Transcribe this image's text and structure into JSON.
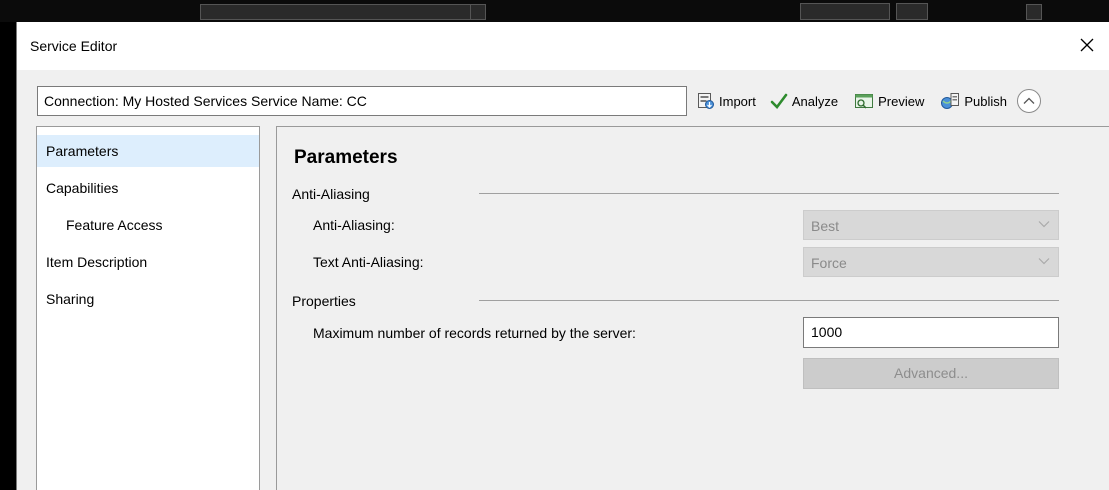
{
  "window": {
    "title": "Service Editor",
    "close_glyph": "✕"
  },
  "connection": {
    "text": "Connection: My Hosted Services   Service Name: CC"
  },
  "toolbar": {
    "import_label": "Import",
    "analyze_label": "Analyze",
    "preview_label": "Preview",
    "publish_label": "Publish",
    "accent": "#2e8b2e"
  },
  "sidebar": {
    "items": [
      {
        "label": "Parameters",
        "selected": true
      },
      {
        "label": "Capabilities"
      },
      {
        "label": "Feature Access"
      },
      {
        "label": "Item Description"
      },
      {
        "label": "Sharing"
      }
    ]
  },
  "main": {
    "heading": "Parameters",
    "anti_aliasing": {
      "section": "Anti-Aliasing",
      "field1_label": "Anti-Aliasing:",
      "field1_value": "Best",
      "field2_label": "Text Anti-Aliasing:",
      "field2_value": "Force"
    },
    "properties": {
      "section": "Properties",
      "max_records_label": "Maximum number of records returned by the server:",
      "max_records_value": "1000",
      "advanced_label": "Advanced..."
    }
  }
}
